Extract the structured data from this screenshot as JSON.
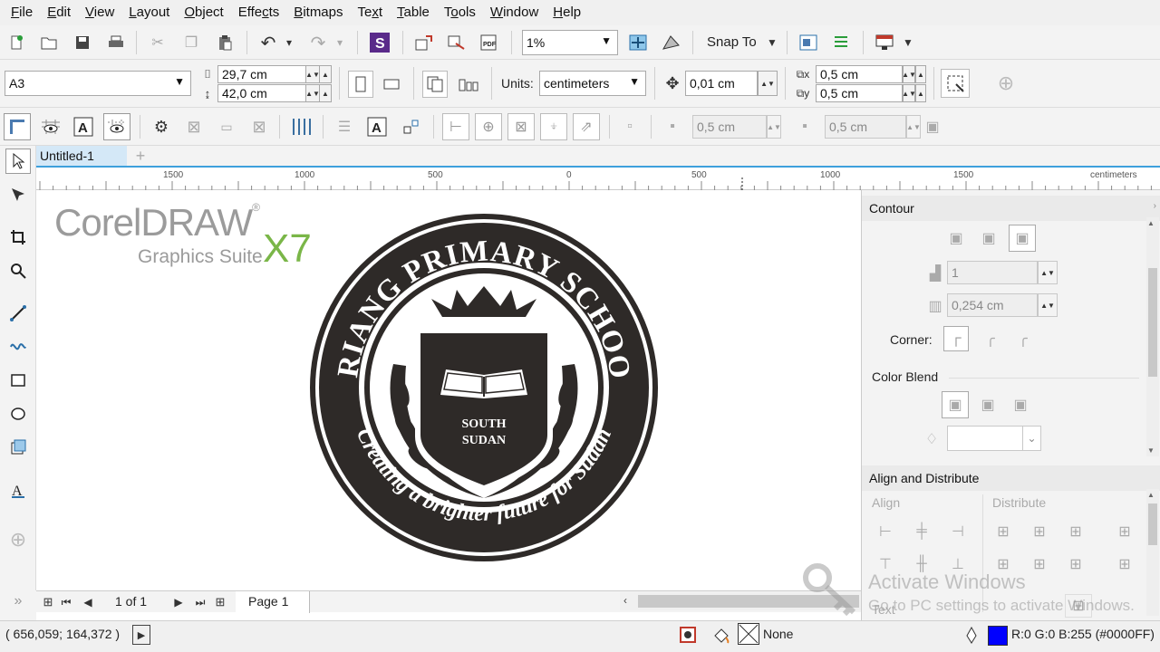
{
  "menu": [
    {
      "label": "File",
      "u": "F",
      "rest": "ile"
    },
    {
      "label": "Edit",
      "u": "E",
      "rest": "dit"
    },
    {
      "label": "View",
      "u": "V",
      "rest": "iew"
    },
    {
      "label": "Layout",
      "u": "L",
      "rest": "ayout"
    },
    {
      "label": "Object",
      "u": "O",
      "rest": "bject"
    },
    {
      "label": "Effects",
      "pre": "Effe",
      "u": "c",
      "rest": "ts"
    },
    {
      "label": "Bitmaps",
      "u": "B",
      "rest": "itmaps"
    },
    {
      "label": "Text",
      "pre": "Te",
      "u": "x",
      "rest": "t"
    },
    {
      "label": "Table",
      "u": "T",
      "rest": "able"
    },
    {
      "label": "Tools",
      "pre": "T",
      "u": "o",
      "rest": "ols"
    },
    {
      "label": "Window",
      "u": "W",
      "rest": "indow"
    },
    {
      "label": "Help",
      "u": "H",
      "rest": "elp"
    }
  ],
  "toolbar": {
    "zoom_value": "1%",
    "snap_label": "Snap To"
  },
  "property_bar": {
    "page_size": "A3",
    "width_value": "29,7 cm",
    "height_value": "42,0 cm",
    "units_label": "Units:",
    "units_value": "centimeters",
    "nudge_value": "0,01 cm",
    "dup_x_value": "0,5 cm",
    "dup_y_value": "0,5 cm"
  },
  "align_bar": {
    "offset_x_value": "0,5 cm",
    "offset_y_value": "0,5 cm"
  },
  "document": {
    "tab_label": "Untitled-1",
    "add_tab": "+"
  },
  "ruler": {
    "labels": [
      "1500",
      "1000",
      "500",
      "0",
      "500",
      "1000",
      "1500"
    ],
    "unit": "centimeters"
  },
  "branding": {
    "corel_light": "Corel",
    "corel_bold": "DRAW",
    "reg": "®",
    "suite": "Graphics Suite",
    "version": "X7"
  },
  "logo": {
    "top_text": "ARIANG PRIMARY SCHOOL",
    "bottom_text": "Creating a brighter future for Sudan",
    "center_line1": "SOUTH",
    "center_line2": "SUDAN",
    "ink_color": "#2e2a28"
  },
  "contour_docker": {
    "title": "Contour",
    "steps_value": "1",
    "offset_value": "0,254 cm",
    "corner_label": "Corner:",
    "color_blend_label": "Color Blend"
  },
  "align_docker": {
    "title": "Align and Distribute",
    "align_label": "Align",
    "distribute_label": "Distribute",
    "text_label": "Text"
  },
  "page_nav": {
    "page_count": "1 of 1",
    "page_tab": "Page 1"
  },
  "status": {
    "coords": "( 656,059; 164,372 )",
    "fill_none": "None",
    "outline_color_text": "R:0 G:0 B:255 (#0000FF)",
    "outline_swatch": "#0000FF"
  },
  "watermark": {
    "line1": "Activate Windows",
    "line2": "Go to PC settings to activate Windows."
  }
}
